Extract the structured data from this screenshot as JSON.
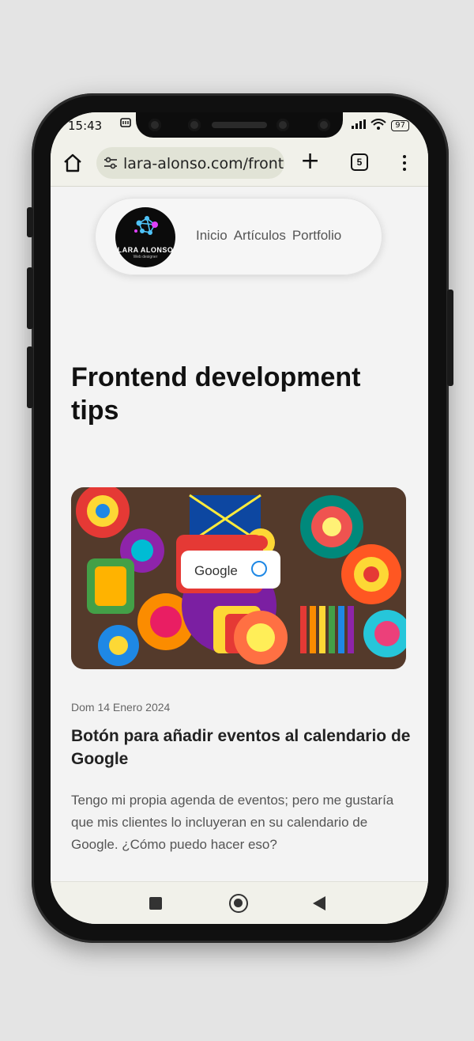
{
  "status_bar": {
    "time": "15:43",
    "battery": "97"
  },
  "browser": {
    "url": "lara-alonso.com/fronte",
    "tab_count": "5"
  },
  "site": {
    "logo_title": "LARA ALONSO",
    "logo_subtitle": "Web designer",
    "nav": [
      "Inicio",
      "Artículos",
      "Portfolio"
    ]
  },
  "page": {
    "title": "Frontend development tips"
  },
  "post": {
    "image_text": "Google",
    "date": "Dom 14 Enero 2024",
    "title": "Botón para añadir eventos al calendario de Google",
    "excerpt": "Tengo mi propia agenda de eventos; pero me gustaría que mis clientes lo incluyeran en su calendario de Google. ¿Cómo puedo hacer eso?"
  },
  "colors": {
    "accent": "#e53935",
    "text": "#111111",
    "muted": "#666666",
    "chrome": "#f1f1ea"
  }
}
